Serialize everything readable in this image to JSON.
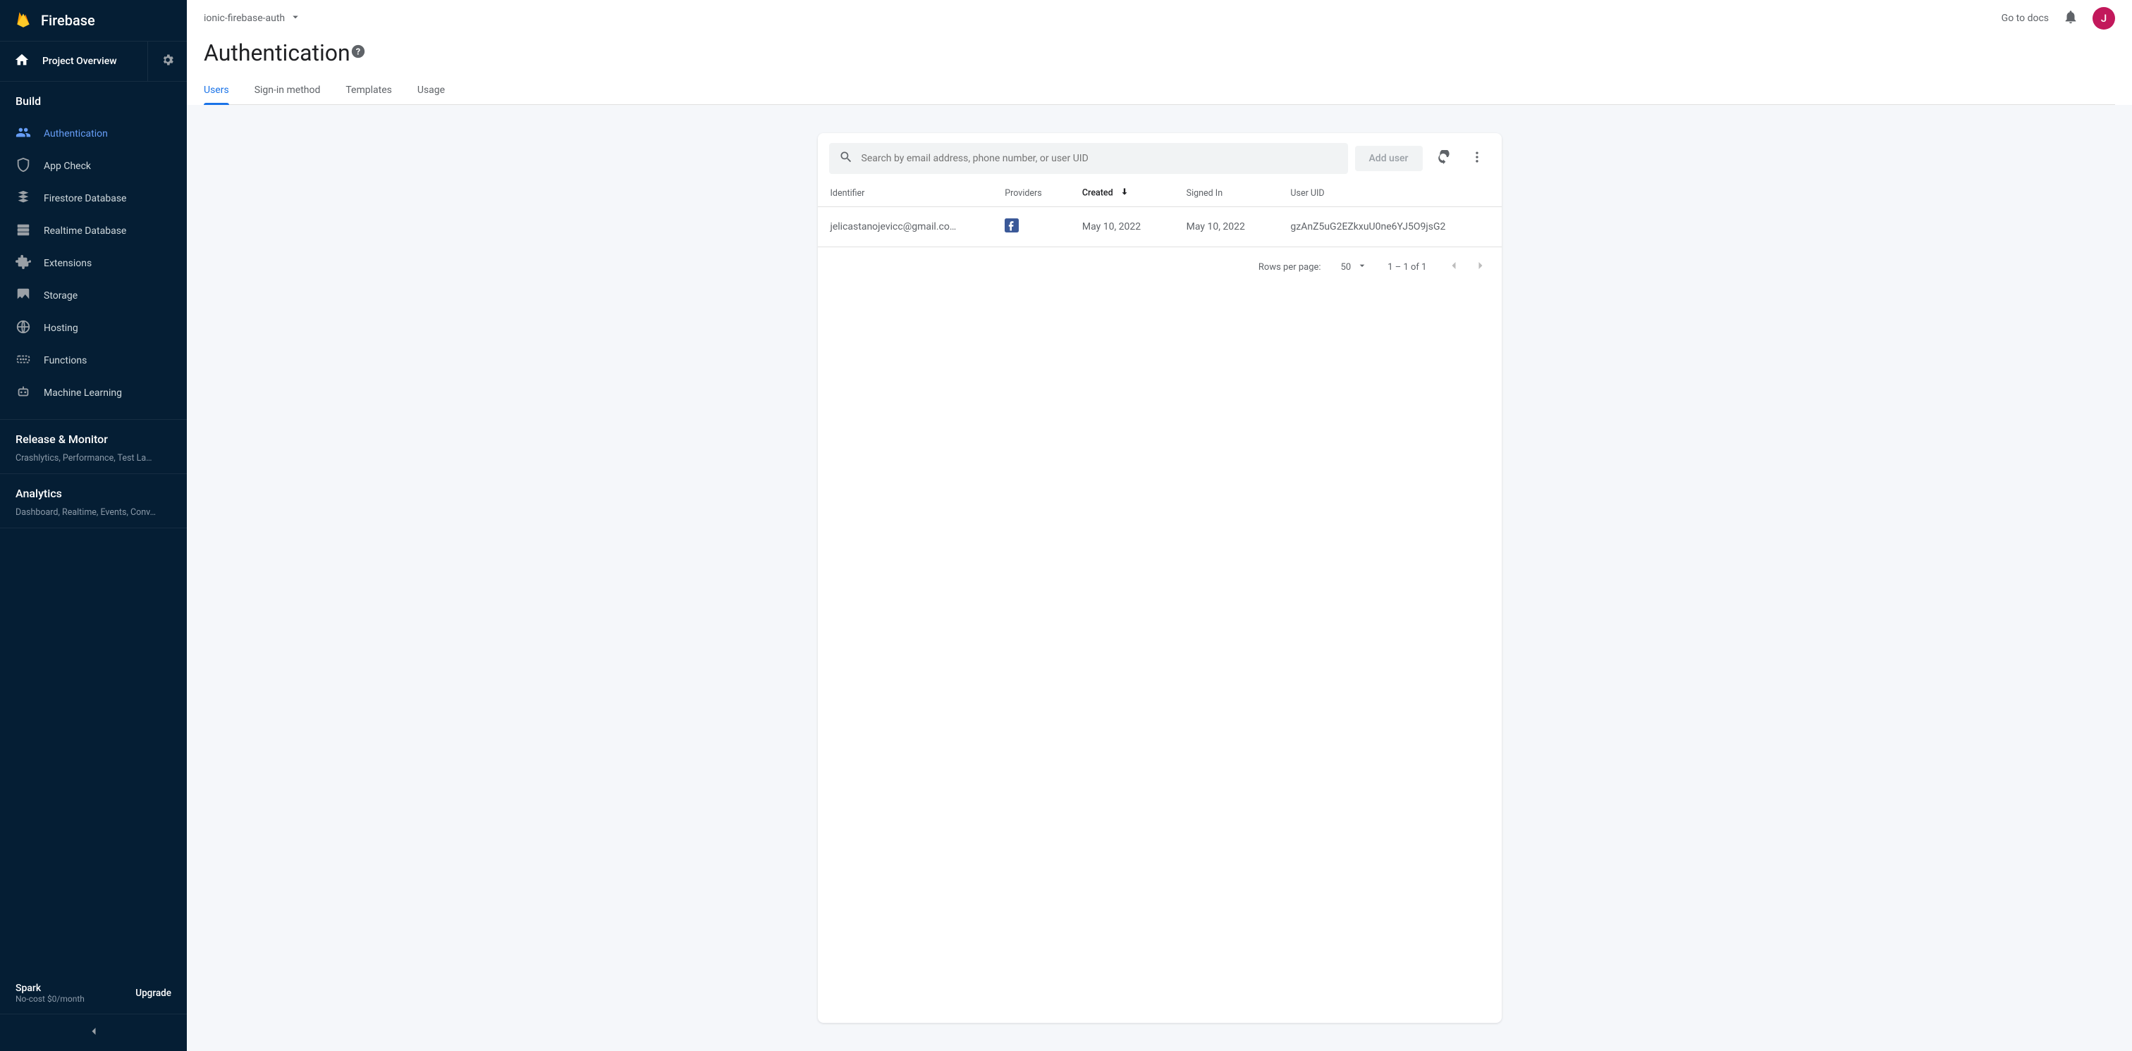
{
  "brand": "Firebase",
  "overview_label": "Project Overview",
  "project_name": "ionic-firebase-auth",
  "docs_link": "Go to docs",
  "avatar_initial": "J",
  "page_title": "Authentication",
  "tabs": [
    {
      "label": "Users",
      "active": true
    },
    {
      "label": "Sign-in method",
      "active": false
    },
    {
      "label": "Templates",
      "active": false
    },
    {
      "label": "Usage",
      "active": false
    }
  ],
  "sidebar": {
    "build": {
      "title": "Build",
      "items": [
        {
          "label": "Authentication",
          "icon": "people",
          "active": true
        },
        {
          "label": "App Check",
          "icon": "shield",
          "active": false
        },
        {
          "label": "Firestore Database",
          "icon": "firestore",
          "active": false
        },
        {
          "label": "Realtime Database",
          "icon": "database",
          "active": false
        },
        {
          "label": "Extensions",
          "icon": "puzzle",
          "active": false
        },
        {
          "label": "Storage",
          "icon": "folder-image",
          "active": false
        },
        {
          "label": "Hosting",
          "icon": "globe",
          "active": false
        },
        {
          "label": "Functions",
          "icon": "functions",
          "active": false
        },
        {
          "label": "Machine Learning",
          "icon": "robot",
          "active": false
        }
      ]
    },
    "release": {
      "title": "Release & Monitor",
      "subtitle": "Crashlytics, Performance, Test La…"
    },
    "analytics": {
      "title": "Analytics",
      "subtitle": "Dashboard, Realtime, Events, Conv…"
    },
    "plan": {
      "name": "Spark",
      "desc": "No-cost $0/month",
      "upgrade": "Upgrade"
    }
  },
  "toolbar": {
    "search_placeholder": "Search by email address, phone number, or user UID",
    "add_user": "Add user"
  },
  "table": {
    "columns": {
      "identifier": "Identifier",
      "providers": "Providers",
      "created": "Created",
      "signed_in": "Signed In",
      "user_uid": "User UID"
    },
    "rows": [
      {
        "identifier": "jelicastanojevicc@gmail.co…",
        "provider": "facebook",
        "created": "May 10, 2022",
        "signed_in": "May 10, 2022",
        "user_uid": "gzAnZ5uG2EZkxuU0ne6YJ5O9jsG2"
      }
    ]
  },
  "pager": {
    "rows_per_page_label": "Rows per page:",
    "rows_per_page_value": "50",
    "range": "1 – 1 of 1"
  }
}
